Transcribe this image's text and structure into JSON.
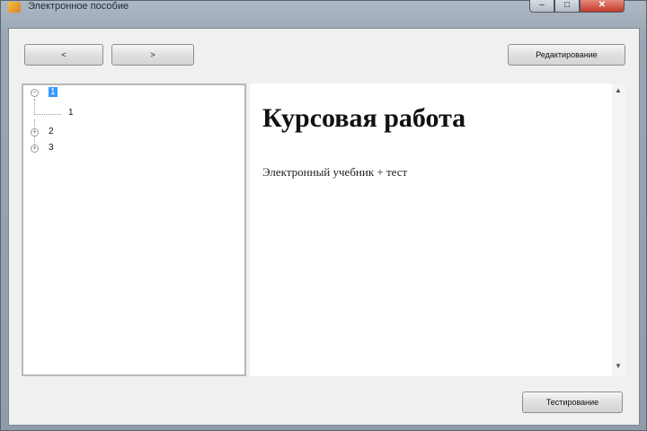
{
  "window": {
    "title": "Электронное пособие",
    "controls": {
      "minimize": "–",
      "maximize": "□",
      "close": "✕"
    }
  },
  "toolbar": {
    "back_label": "<",
    "forward_label": ">",
    "edit_label": "Редактирование"
  },
  "tree": {
    "nodes": [
      {
        "label": "1",
        "expander": "−",
        "selected": true
      },
      {
        "label": "1",
        "child": true
      },
      {
        "label": "2",
        "expander": "+"
      },
      {
        "label": "3",
        "expander": "+"
      }
    ]
  },
  "content": {
    "heading": "Курсовая работа",
    "paragraph": "Электронный учебник + тест"
  },
  "scrollbar": {
    "up": "▲",
    "down": "▼"
  },
  "footer": {
    "testing_label": "Тестирование"
  }
}
